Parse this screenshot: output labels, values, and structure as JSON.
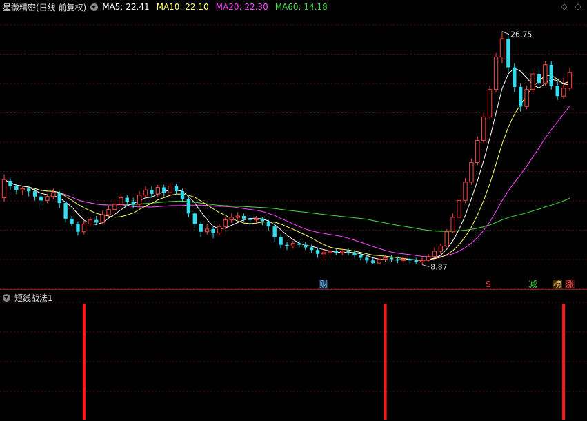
{
  "header": {
    "title": "星徽精密(日线 前复权)",
    "ma": [
      {
        "label": "MA5: 22.41",
        "color": "#ffffff"
      },
      {
        "label": "MA10: 22.10",
        "color": "#ffff66"
      },
      {
        "label": "MA20: 22.30",
        "color": "#ff44ff"
      },
      {
        "label": "MA60: 14.18",
        "color": "#44dd44"
      }
    ]
  },
  "indicator": {
    "title": "短线战法1"
  },
  "annotations": {
    "high_label": "26.75",
    "low_label": "8.87"
  },
  "signals": [
    {
      "text": "财",
      "color": "#66ccff",
      "bg": "#222a40"
    },
    {
      "text": "S",
      "color": "#ff3333",
      "bg": ""
    },
    {
      "text": "减",
      "color": "#44dd44",
      "bg": ""
    },
    {
      "text": "榜",
      "color": "#ffcc66",
      "bg": "#3a2a10"
    },
    {
      "text": "跌",
      "color": "#44dd44",
      "bg": "#0c2a0c"
    },
    {
      "text": "涨",
      "color": "#ff4444",
      "bg": "#3a1010"
    }
  ],
  "colors": {
    "up": "#ff4444",
    "down": "#33ddee",
    "grid": "#551111",
    "signal_bar": "#ff1a1a"
  },
  "chart_data": {
    "type": "candlestick",
    "price_range": [
      8.0,
      28.0
    ],
    "candles": [
      [
        14.0,
        15.4,
        13.7,
        15.8
      ],
      [
        15.3,
        14.9,
        14.6,
        15.5
      ],
      [
        14.9,
        14.6,
        14.3,
        15.1
      ],
      [
        14.6,
        14.7,
        14.2,
        14.9
      ],
      [
        14.7,
        14.5,
        14.1,
        14.9
      ],
      [
        14.5,
        14.1,
        13.8,
        14.7
      ],
      [
        14.1,
        13.8,
        13.4,
        14.4
      ],
      [
        13.8,
        14.1,
        13.6,
        14.3
      ],
      [
        14.1,
        14.4,
        13.9,
        14.7
      ],
      [
        14.4,
        13.6,
        13.2,
        14.5
      ],
      [
        13.6,
        12.4,
        12.1,
        13.7
      ],
      [
        12.4,
        12.0,
        11.8,
        12.6
      ],
      [
        12.0,
        11.4,
        11.1,
        12.2
      ],
      [
        11.4,
        12.0,
        11.2,
        12.3
      ],
      [
        12.0,
        12.3,
        11.8,
        12.5
      ],
      [
        12.3,
        12.1,
        11.9,
        12.6
      ],
      [
        12.1,
        12.7,
        12.0,
        13.0
      ],
      [
        12.7,
        13.1,
        12.5,
        13.4
      ],
      [
        13.1,
        13.5,
        12.9,
        13.8
      ],
      [
        13.5,
        14.0,
        13.3,
        14.3
      ],
      [
        14.0,
        13.7,
        13.4,
        14.2
      ],
      [
        13.7,
        13.5,
        13.2,
        14.0
      ],
      [
        13.5,
        14.2,
        13.3,
        14.5
      ],
      [
        14.2,
        14.6,
        14.0,
        14.9
      ],
      [
        14.6,
        14.3,
        14.0,
        14.9
      ],
      [
        14.3,
        14.8,
        14.1,
        15.0
      ],
      [
        14.8,
        14.4,
        14.1,
        15.0
      ],
      [
        14.4,
        14.9,
        14.2,
        15.2
      ],
      [
        14.9,
        14.5,
        14.2,
        15.1
      ],
      [
        14.5,
        13.9,
        13.7,
        14.7
      ],
      [
        13.9,
        12.8,
        12.5,
        14.1
      ],
      [
        12.8,
        12.0,
        11.7,
        12.9
      ],
      [
        12.0,
        11.4,
        11.0,
        12.2
      ],
      [
        11.4,
        11.6,
        11.2,
        12.0
      ],
      [
        11.6,
        11.3,
        10.9,
        11.8
      ],
      [
        11.3,
        11.8,
        11.1,
        12.0
      ],
      [
        11.8,
        12.3,
        11.6,
        12.5
      ],
      [
        12.3,
        12.5,
        12.1,
        12.8
      ],
      [
        12.5,
        12.6,
        12.3,
        12.9
      ],
      [
        12.6,
        12.4,
        12.2,
        12.8
      ],
      [
        12.4,
        12.3,
        12.0,
        12.6
      ],
      [
        12.3,
        12.4,
        12.1,
        12.6
      ],
      [
        12.4,
        12.2,
        11.9,
        12.5
      ],
      [
        12.2,
        11.8,
        11.5,
        12.3
      ],
      [
        11.8,
        11.0,
        10.6,
        12.0
      ],
      [
        11.0,
        10.4,
        10.1,
        11.2
      ],
      [
        10.4,
        10.3,
        10.0,
        10.6
      ],
      [
        10.3,
        10.5,
        10.1,
        10.7
      ],
      [
        10.5,
        10.4,
        10.2,
        10.7
      ],
      [
        10.4,
        10.2,
        10.0,
        10.6
      ],
      [
        10.2,
        10.0,
        9.8,
        10.4
      ],
      [
        10.0,
        9.7,
        9.4,
        10.2
      ],
      [
        9.7,
        9.8,
        9.2,
        10.1
      ],
      [
        9.8,
        9.9,
        9.6,
        10.1
      ],
      [
        9.9,
        9.8,
        9.6,
        10.1
      ],
      [
        9.8,
        9.9,
        9.6,
        10.1
      ],
      [
        9.9,
        9.8,
        9.6,
        10.1
      ],
      [
        9.8,
        9.6,
        9.4,
        10.0
      ],
      [
        9.6,
        9.4,
        9.2,
        9.8
      ],
      [
        9.4,
        9.2,
        9.0,
        9.6
      ],
      [
        9.2,
        9.0,
        8.9,
        9.4
      ],
      [
        9.0,
        9.3,
        8.9,
        9.5
      ],
      [
        9.3,
        9.4,
        9.1,
        9.6
      ],
      [
        9.4,
        9.3,
        9.1,
        9.6
      ],
      [
        9.3,
        9.2,
        9.0,
        9.5
      ],
      [
        9.2,
        9.3,
        9.0,
        9.5
      ],
      [
        9.3,
        9.2,
        9.0,
        9.5
      ],
      [
        9.2,
        9.1,
        8.9,
        9.4
      ],
      [
        9.1,
        9.2,
        8.87,
        9.4
      ],
      [
        9.2,
        9.5,
        9.1,
        9.7
      ],
      [
        9.5,
        9.9,
        9.4,
        10.2
      ],
      [
        9.9,
        10.3,
        9.7,
        10.5
      ],
      [
        10.3,
        11.4,
        10.2,
        11.6
      ],
      [
        11.4,
        12.5,
        11.3,
        12.8
      ],
      [
        12.5,
        13.8,
        12.4,
        14.0
      ],
      [
        13.8,
        15.2,
        13.6,
        15.5
      ],
      [
        15.2,
        16.7,
        15.0,
        17.0
      ],
      [
        16.7,
        18.4,
        16.5,
        18.7
      ],
      [
        18.4,
        20.2,
        18.2,
        20.5
      ],
      [
        20.2,
        22.3,
        20.0,
        22.6
      ],
      [
        22.3,
        24.8,
        22.1,
        25.1
      ],
      [
        24.8,
        26.2,
        24.3,
        26.75
      ],
      [
        26.2,
        24.0,
        23.6,
        26.4
      ],
      [
        24.0,
        22.5,
        22.1,
        24.3
      ],
      [
        22.5,
        21.0,
        20.6,
        22.8
      ],
      [
        21.0,
        22.3,
        20.8,
        22.6
      ],
      [
        22.3,
        23.5,
        22.0,
        23.8
      ],
      [
        23.5,
        22.8,
        22.5,
        24.0
      ],
      [
        22.8,
        24.2,
        22.6,
        24.5
      ],
      [
        24.2,
        22.6,
        22.3,
        24.5
      ],
      [
        22.6,
        21.8,
        21.5,
        23.0
      ],
      [
        21.8,
        22.4,
        21.6,
        23.2
      ],
      [
        22.4,
        23.6,
        22.2,
        24.0
      ]
    ],
    "signal_bars": [
      13,
      62,
      91
    ]
  }
}
